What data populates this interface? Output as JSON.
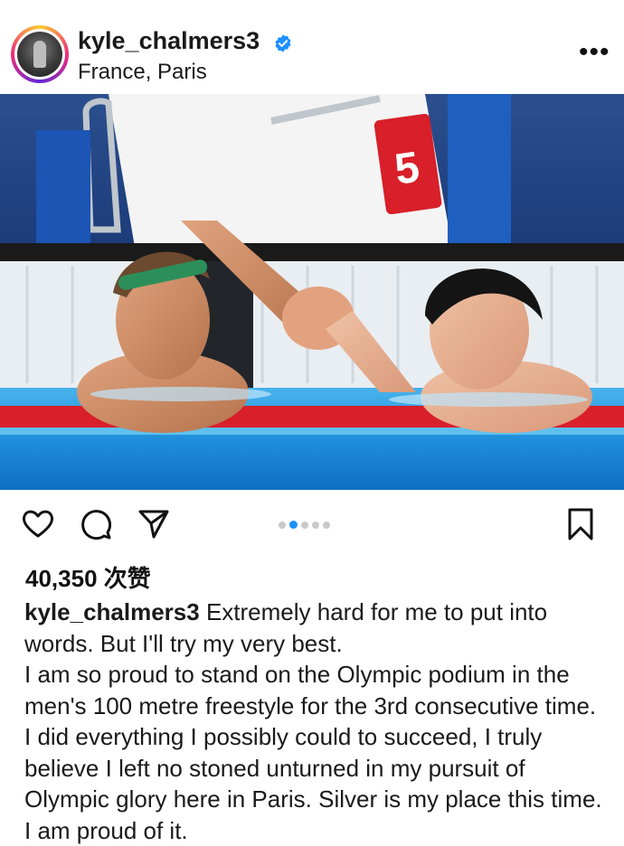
{
  "post": {
    "username": "kyle_chalmers3",
    "location": "France, Paris",
    "verified_icon": "verified-badge-icon",
    "more_icon": "more-options-icon",
    "more_label": "•••"
  },
  "actions": {
    "icons": [
      "heart-icon",
      "comment-icon",
      "share-icon",
      "bookmark-icon"
    ],
    "carousel_dot_count": 5,
    "carousel_active_index": 1
  },
  "likes": "40,350 次赞",
  "caption": {
    "username": "kyle_chalmers3",
    "first": " Extremely hard for me to put into words. But I'll try my very best.",
    "body": "I am so proud to stand on the Olympic podium in the men's 100 metre freestyle for the 3rd consecutive time. I did everything I possibly could to succeed, I truly believe I left no stoned unturned in my pursuit of Olympic glory here in Paris. Silver is my place this time. I am proud of it."
  },
  "colors": {
    "accent_blue": "#1e90ff",
    "pool_lane_red": "#d81f2a",
    "pool_water": "#2f9be0"
  }
}
